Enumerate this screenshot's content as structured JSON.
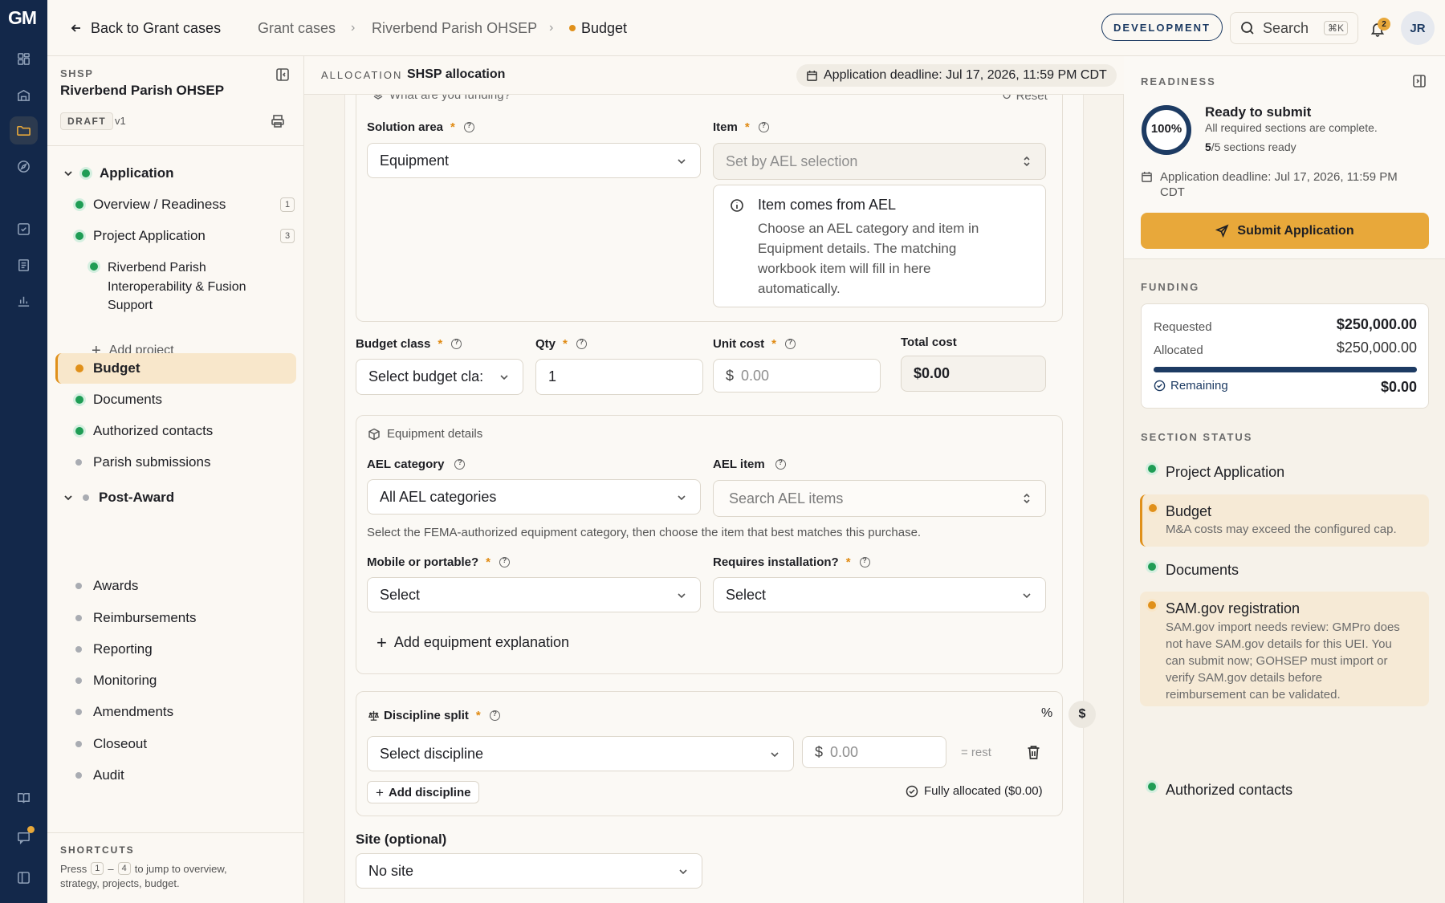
{
  "brand": {
    "logo": "GM"
  },
  "topbar": {
    "back_label": "Back to Grant cases",
    "breadcrumb": [
      "Grant cases",
      "Riverbend Parish OHSEP",
      "Budget"
    ],
    "env_badge": "DEVELOPMENT",
    "search_label": "Search",
    "search_shortcut": "⌘K",
    "notification_count": "2",
    "avatar_initials": "JR"
  },
  "sidebar": {
    "program": "SHSP",
    "org_name": "Riverbend Parish OHSEP",
    "status_badge": "DRAFT",
    "version": "v1",
    "groups": [
      {
        "label": "Application"
      },
      {
        "label": "Post-Award"
      }
    ],
    "items": [
      {
        "label": "Overview / Readiness",
        "count": "1",
        "status": "complete"
      },
      {
        "label": "Project Application",
        "count": "3",
        "status": "complete"
      },
      {
        "label": "Riverbend Parish Interoperability & Fusion Support",
        "status": "complete"
      },
      {
        "label": "Add project"
      },
      {
        "label": "Budget",
        "status": "warning"
      },
      {
        "label": "Documents",
        "status": "complete"
      },
      {
        "label": "Authorized contacts",
        "status": "complete"
      },
      {
        "label": "Parish submissions",
        "status": "none"
      }
    ],
    "post_award_items": [
      "Awards",
      "Reimbursements",
      "Reporting",
      "Monitoring",
      "Amendments",
      "Closeout",
      "Audit"
    ],
    "shortcuts": {
      "title": "SHORTCUTS",
      "text_before": "Press",
      "key_from": "1",
      "dash": "–",
      "key_to": "4",
      "text_after": "to jump to overview,",
      "text_line2": "strategy, projects, budget."
    }
  },
  "subheader": {
    "allocation_label": "ALLOCATION",
    "allocation_value": "SHSP allocation",
    "deadline": "Application deadline: Jul 17, 2026, 11:59 PM CDT"
  },
  "form": {
    "top_question": "What are you funding?",
    "reset_label": "Reset",
    "solution_area": {
      "label": "Solution area",
      "value": "Equipment"
    },
    "item": {
      "label": "Item",
      "placeholder": "Set by AEL selection"
    },
    "info": {
      "title": "Item comes from AEL",
      "lines": [
        "Choose an AEL category and item in",
        "Equipment details. The matching",
        "workbook item will fill in here",
        "automatically."
      ]
    },
    "budget_class": {
      "label": "Budget class",
      "placeholder": "Select budget cla:"
    },
    "qty": {
      "label": "Qty",
      "value": "1"
    },
    "unit_cost": {
      "label": "Unit cost",
      "prefix": "$",
      "placeholder": "0.00"
    },
    "total_cost": {
      "label": "Total cost",
      "value": "$0.00"
    },
    "equipment": {
      "section_title": "Equipment details",
      "ael_category": {
        "label": "AEL category",
        "value": "All AEL categories"
      },
      "ael_item": {
        "label": "AEL item",
        "placeholder": "Search AEL items"
      },
      "hint": "Select the FEMA-authorized equipment category, then choose the item that best matches this purchase.",
      "mobile": {
        "label": "Mobile or portable?",
        "value": "Select"
      },
      "install": {
        "label": "Requires installation?",
        "value": "Select"
      },
      "add_explanation": "Add equipment explanation"
    },
    "discipline": {
      "label": "Discipline split",
      "toggle_pct": "%",
      "toggle_usd": "$",
      "select_placeholder": "Select discipline",
      "amount_prefix": "$",
      "amount_placeholder": "0.00",
      "rest_label": "= rest",
      "add_label": "Add discipline",
      "status": "Fully allocated ($0.00)"
    },
    "site": {
      "label": "Site (optional)",
      "value": "No site"
    }
  },
  "readiness": {
    "title": "READINESS",
    "percent": "100%",
    "percent_value": 100,
    "headline": "Ready to submit",
    "subline": "All required sections are complete.",
    "sections_done": "5",
    "sections_total": "/5 sections ready",
    "deadline_line1": "Application deadline: Jul 17, 2026, 11:59 PM",
    "deadline_line2": "CDT",
    "submit_label": "Submit Application"
  },
  "funding": {
    "title": "FUNDING",
    "requested_label": "Requested",
    "requested_value": "$250,000.00",
    "allocated_label": "Allocated",
    "allocated_value": "$250,000.00",
    "allocated_fraction": 1.0,
    "remaining_label": "Remaining",
    "remaining_value": "$0.00"
  },
  "section_status": {
    "title": "SECTION STATUS",
    "items": [
      {
        "name": "Project Application",
        "status": "complete"
      },
      {
        "name": "Budget",
        "status": "warning",
        "detail": "M&A costs may exceed the configured cap."
      },
      {
        "name": "Documents",
        "status": "complete"
      },
      {
        "name": "SAM.gov registration",
        "status": "warning",
        "detail_lines": [
          "SAM.gov import needs review: GMPro does",
          "not have SAM.gov details for this UEI. You",
          "can submit now; GOHSEP must import or",
          "verify SAM.gov details before",
          "reimbursement can be validated."
        ]
      },
      {
        "name": "Authorized contacts",
        "status": "complete"
      }
    ]
  },
  "colors": {
    "rail": "#13284a",
    "accent": "#e8a83a",
    "complete": "#1f9d55",
    "warning": "#e0901a",
    "progress": "#1d3b63"
  },
  "rail_icons": [
    "dashboard-icon",
    "building-icon",
    "folder-icon",
    "compass-icon",
    "checklist-icon",
    "receipt-icon",
    "chart-icon",
    "book-icon",
    "chat-icon",
    "panel-icon"
  ]
}
